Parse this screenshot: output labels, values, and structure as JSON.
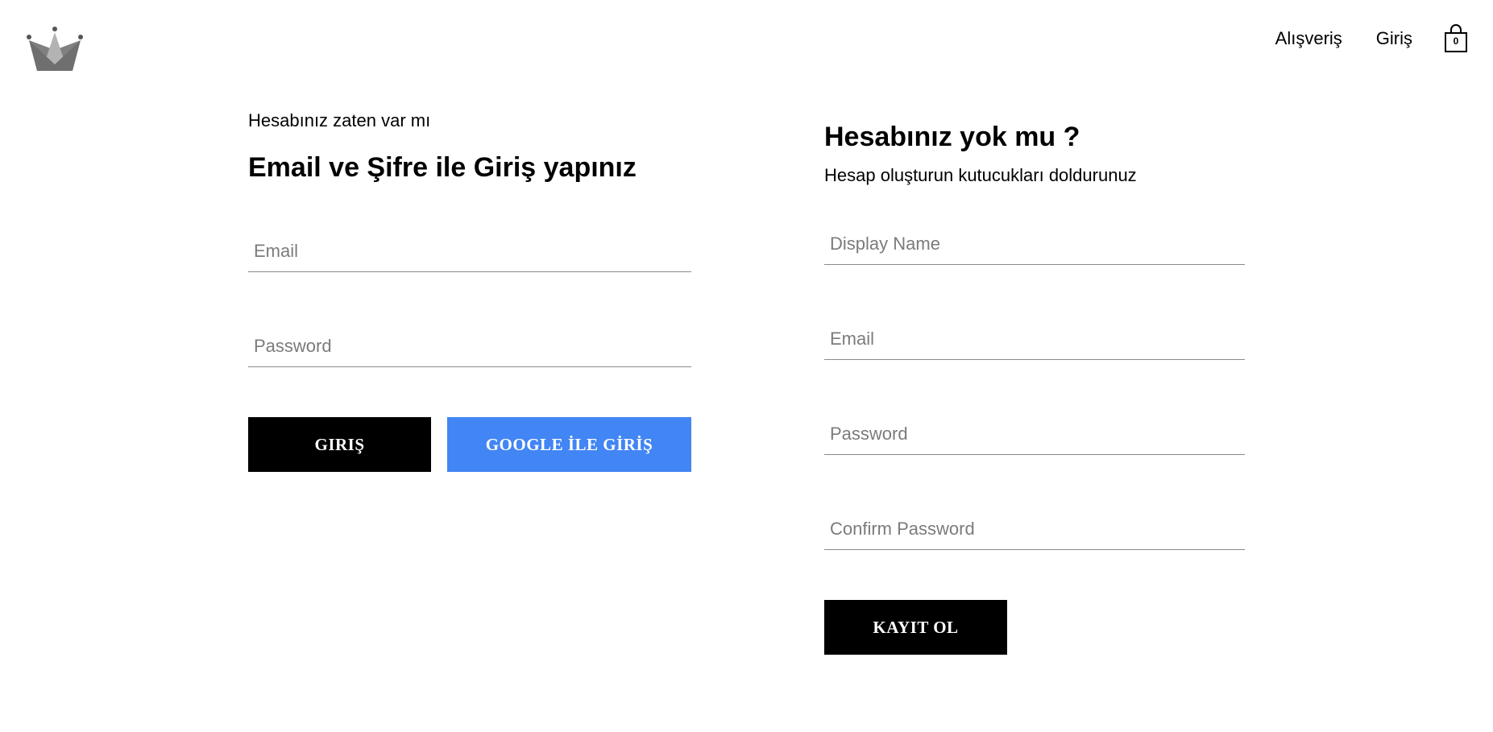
{
  "header": {
    "logo_icon": "crown-icon",
    "nav": {
      "shop_label": "Alışveriş",
      "signin_label": "Giriş"
    },
    "cart": {
      "icon": "shopping-bag-icon",
      "count": "0"
    }
  },
  "signin": {
    "subtitle": "Hesabınız zaten var mı",
    "title": "Email ve Şifre ile Giriş yapınız",
    "email_placeholder": "Email",
    "password_placeholder": "Password",
    "signin_button": "GIRIŞ",
    "google_button": "GOOGLE İLE GİRİŞ",
    "google_button_color": "#4285f4"
  },
  "signup": {
    "title": "Hesabınız yok mu ?",
    "subtitle": "Hesap oluşturun kutucukları doldurunuz",
    "display_name_placeholder": "Display Name",
    "email_placeholder": "Email",
    "password_placeholder": "Password",
    "confirm_password_placeholder": "Confirm Password",
    "register_button": "KAYIT OL"
  }
}
